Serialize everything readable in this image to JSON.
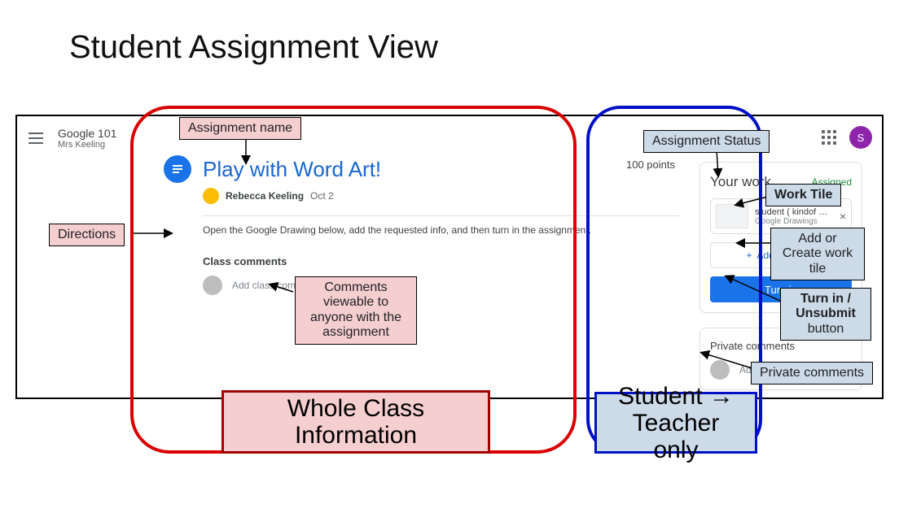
{
  "slide": {
    "title": "Student Assignment View"
  },
  "header": {
    "class_name": "Google 101",
    "teacher_name": "Mrs Keeling",
    "avatar_initial": "S"
  },
  "assignment": {
    "icon_glyph": "≡",
    "title": "Play with Word Art!",
    "points": "100 points",
    "author": "Rebecca Keeling",
    "date": "Oct 2",
    "directions": "Open the Google Drawing below, add the requested info, and then turn in the assignment.",
    "class_comments_header": "Class comments",
    "class_comment_placeholder": "Add class comment..."
  },
  "your_work": {
    "title": "Your work",
    "status": "Assigned",
    "tile_title": "student ( kindof ) ...",
    "tile_subtitle": "Google Drawings",
    "tile_close_glyph": "×",
    "add_button_glyph": "+",
    "add_button_label": "Add or create",
    "turn_in_label": "Turn in"
  },
  "private": {
    "title": "Private comments",
    "placeholder": "Add private comment..."
  },
  "annotations": {
    "assignment_name": "Assignment name",
    "directions": "Directions",
    "class_comments_note": "Comments viewable to anyone with the assignment",
    "assignment_status": "Assignment Status",
    "work_tile": "Work Tile",
    "add_or_create": "Add or Create work tile",
    "turn_in_unsubmit": "Turn in / Unsubmit button",
    "turn_in_unsubmit_line1": "Turn in /",
    "turn_in_unsubmit_line2": "Unsubmit",
    "turn_in_unsubmit_line3": "button",
    "private_comments": "Private comments",
    "whole_class": "Whole Class Information",
    "student_teacher": "Student → Teacher only"
  }
}
